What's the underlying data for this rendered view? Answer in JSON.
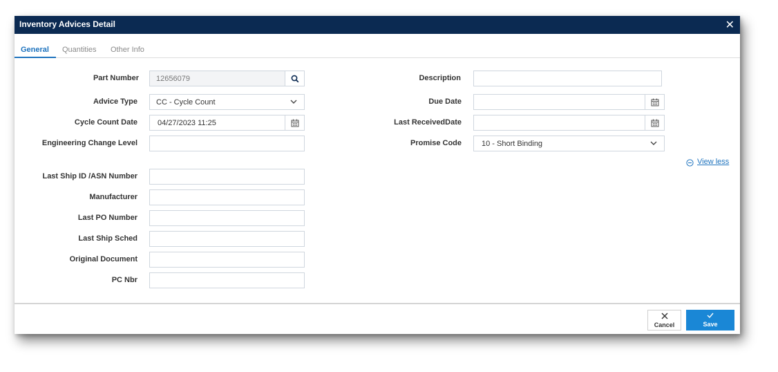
{
  "dialog": {
    "title": "Inventory Advices Detail"
  },
  "tabs": [
    {
      "label": "General",
      "active": true
    },
    {
      "label": "Quantities",
      "active": false
    },
    {
      "label": "Other Info",
      "active": false
    }
  ],
  "form_left": {
    "part_number": {
      "label": "Part Number",
      "value": "12656079"
    },
    "advice_type": {
      "label": "Advice Type",
      "value": "CC - Cycle Count"
    },
    "cycle_count_date": {
      "label": "Cycle Count Date",
      "value": "04/27/2023 11:25"
    },
    "engineering_change_level": {
      "label": "Engineering Change Level",
      "value": ""
    },
    "last_ship_id": {
      "label": "Last Ship ID /ASN Number",
      "value": ""
    },
    "manufacturer": {
      "label": "Manufacturer",
      "value": ""
    },
    "last_po_number": {
      "label": "Last PO Number",
      "value": ""
    },
    "last_ship_sched": {
      "label": "Last Ship Sched",
      "value": ""
    },
    "original_document": {
      "label": "Original Document",
      "value": ""
    },
    "pc_nbr": {
      "label": "PC Nbr",
      "value": ""
    }
  },
  "form_right": {
    "description": {
      "label": "Description",
      "value": ""
    },
    "due_date": {
      "label": "Due Date",
      "value": ""
    },
    "last_received_date": {
      "label": "Last ReceivedDate",
      "value": ""
    },
    "promise_code": {
      "label": "Promise Code",
      "value": "10 - Short Binding"
    }
  },
  "view_less": {
    "label": "View less"
  },
  "footer": {
    "cancel_label": "Cancel",
    "save_label": "Save"
  },
  "colors": {
    "titlebar": "#0b2a52",
    "accent": "#1e73be",
    "save_button": "#1a87d6"
  }
}
